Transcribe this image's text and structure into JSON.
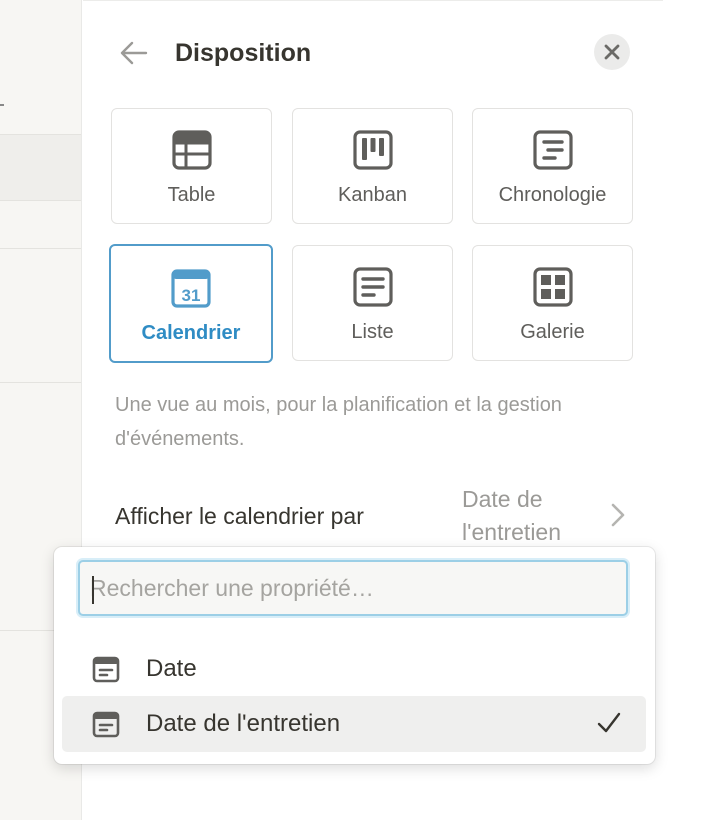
{
  "panel": {
    "title": "Disposition"
  },
  "layouts": [
    {
      "id": "table",
      "label": "Table",
      "icon": "table-icon",
      "selected": false
    },
    {
      "id": "kanban",
      "label": "Kanban",
      "icon": "kanban-icon",
      "selected": false
    },
    {
      "id": "chronologie",
      "label": "Chronologie",
      "icon": "timeline-icon",
      "selected": false
    },
    {
      "id": "calendrier",
      "label": "Calendrier",
      "icon": "calendar-icon",
      "selected": true
    },
    {
      "id": "liste",
      "label": "Liste",
      "icon": "list-icon",
      "selected": false
    },
    {
      "id": "galerie",
      "label": "Galerie",
      "icon": "gallery-icon",
      "selected": false
    }
  ],
  "description": "Une vue au mois, pour la planification et la gestion d'événements.",
  "calendar_icon_day": "31",
  "property": {
    "label": "Afficher le calendrier par",
    "value": "Date de l'entretien"
  },
  "dropdown": {
    "search_placeholder": "Rechercher une propriété…",
    "search_value": "",
    "options": [
      {
        "label": "Date",
        "icon": "date-property-icon",
        "selected": false
      },
      {
        "label": "Date de l'entretien",
        "icon": "date-property-icon",
        "selected": true
      }
    ]
  },
  "colors": {
    "accent": "#529cca",
    "text": "#37352f",
    "muted": "#9b9a97"
  }
}
